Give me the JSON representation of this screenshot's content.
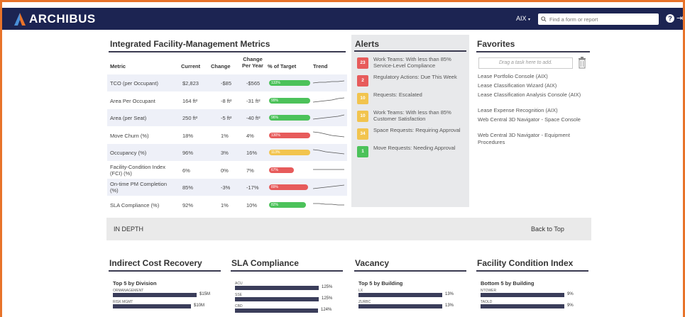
{
  "app": {
    "brand": "ARCHIBUS",
    "workspace": "AIX",
    "search_placeholder": "Find a form or report",
    "help_glyph": "?",
    "logout_glyph": "⇥",
    "accent": "#1c2452"
  },
  "metrics": {
    "title": "Integrated Facility-Management Metrics",
    "headers": {
      "metric": "Metric",
      "current": "Current",
      "change": "Change",
      "change_year_1": "Change",
      "change_year_2": "Per Year",
      "target": "% of Target",
      "trend": "Trend"
    },
    "rows": [
      {
        "metric": "TCO (per Occupant)",
        "current": "$2,823",
        "change": "-$85",
        "per_year": "-$565",
        "target": "133%",
        "fill": 1.0,
        "color": "#4cc25a",
        "alt": true,
        "trend": [
          6,
          7,
          7,
          8,
          8,
          9
        ]
      },
      {
        "metric": "Area Per Occupant",
        "current": "164 ft²",
        "change": "-8 ft²",
        "per_year": "-31 ft²",
        "target": "99%",
        "fill": 1.0,
        "color": "#4cc25a",
        "alt": false,
        "trend": [
          4,
          5,
          6,
          7,
          9,
          10
        ]
      },
      {
        "metric": "Area (per Seat)",
        "current": "250 ft²",
        "change": "-5 ft²",
        "per_year": "-40 ft²",
        "target": "96%",
        "fill": 1.0,
        "color": "#4cc25a",
        "alt": true,
        "trend": [
          4,
          5,
          6,
          7,
          8,
          10
        ]
      },
      {
        "metric": "Move Churn (%)",
        "current": "18%",
        "change": "1%",
        "per_year": "4%",
        "target": "130%",
        "fill": 1.0,
        "color": "#e75b5b",
        "alt": false,
        "trend": [
          11,
          10,
          8,
          6,
          5,
          4
        ]
      },
      {
        "metric": "Occupancy (%)",
        "current": "96%",
        "change": "3%",
        "per_year": "16%",
        "target": "113%",
        "fill": 1.0,
        "color": "#f2c44e",
        "alt": true,
        "trend": [
          10,
          9,
          7,
          6,
          5,
          4
        ]
      },
      {
        "metric": "Facility-Condition Index (FCI) (%)",
        "current": "6%",
        "change": "0%",
        "per_year": "7%",
        "target": "67%",
        "fill": 0.6,
        "color": "#e75b5b",
        "alt": false,
        "trend": [
          7,
          7,
          7,
          7,
          7,
          7
        ]
      },
      {
        "metric": "On-time PM Completion (%)",
        "current": "85%",
        "change": "-3%",
        "per_year": "-17%",
        "target": "89%",
        "fill": 0.95,
        "color": "#e75b5b",
        "alt": true,
        "trend": [
          4,
          5,
          6,
          7,
          8,
          9
        ]
      },
      {
        "metric": "SLA Compliance (%)",
        "current": "92%",
        "change": "1%",
        "per_year": "10%",
        "target": "82%",
        "fill": 0.9,
        "color": "#4cc25a",
        "alt": false,
        "trend": [
          8,
          8,
          7,
          7,
          6,
          6
        ]
      }
    ]
  },
  "alerts": {
    "title": "Alerts",
    "items": [
      {
        "count": "23",
        "text": "Work Teams: With less than 85% Service-Level Compliance",
        "color": "#e75b5b"
      },
      {
        "count": "2",
        "text": "Regulatory Actions: Due This Week",
        "color": "#e75b5b"
      },
      {
        "count": "10",
        "text": "Requests: Escalated",
        "color": "#f2c44e"
      },
      {
        "count": "10",
        "text": "Work Teams: With less than 85% Customer Satisfaction",
        "color": "#f2c44e"
      },
      {
        "count": "34",
        "text": "Space Requests: Requiring Approval",
        "color": "#f2c44e"
      },
      {
        "count": "1",
        "text": "Move Requests: Needing Approval",
        "color": "#4cc25a"
      }
    ]
  },
  "favorites": {
    "title": "Favorites",
    "drop_hint": "Drag a task here to add.",
    "items": [
      "Lease Portfolio Console (AIX)",
      "Lease Classification Wizard (AIX)",
      "Lease Classification Analysis Console (AIX)",
      "Lease Expense Recognition (AIX)",
      "Web Central 3D Navigator - Space Console",
      "Web Central 3D Navigator - Equipment Procedures"
    ]
  },
  "in_depth": {
    "title": "IN DEPTH",
    "back_to_top": "Back to Top"
  },
  "sections": [
    {
      "title": "Indirect Cost Recovery",
      "subtitle": "Top 5 by Division",
      "bars": [
        {
          "label": "ORMANAGEMENT",
          "value": "$15M",
          "fill": 1.0
        },
        {
          "label": "RISK MGMT",
          "value": "$10M",
          "fill": 0.93
        }
      ]
    },
    {
      "title": "SLA Compliance",
      "subtitle": "",
      "bars": [
        {
          "label": "ACU",
          "value": "125%",
          "fill": 1.0
        },
        {
          "label": "SSE",
          "value": "125%",
          "fill": 1.0
        },
        {
          "label": "CBD",
          "value": "124%",
          "fill": 0.99
        }
      ]
    },
    {
      "title": "Vacancy",
      "subtitle": "Top 5 by Building",
      "bars": [
        {
          "label": "LX",
          "value": "13%",
          "fill": 1.0
        },
        {
          "label": "ZURBC",
          "value": "13%",
          "fill": 1.0
        }
      ]
    },
    {
      "title": "Facility Condition Index",
      "subtitle": "Bottom 5 by Building",
      "bars": [
        {
          "label": "NTOWER",
          "value": "9%",
          "fill": 1.0
        },
        {
          "label": "TAOLD",
          "value": "9%",
          "fill": 1.0
        }
      ]
    }
  ]
}
